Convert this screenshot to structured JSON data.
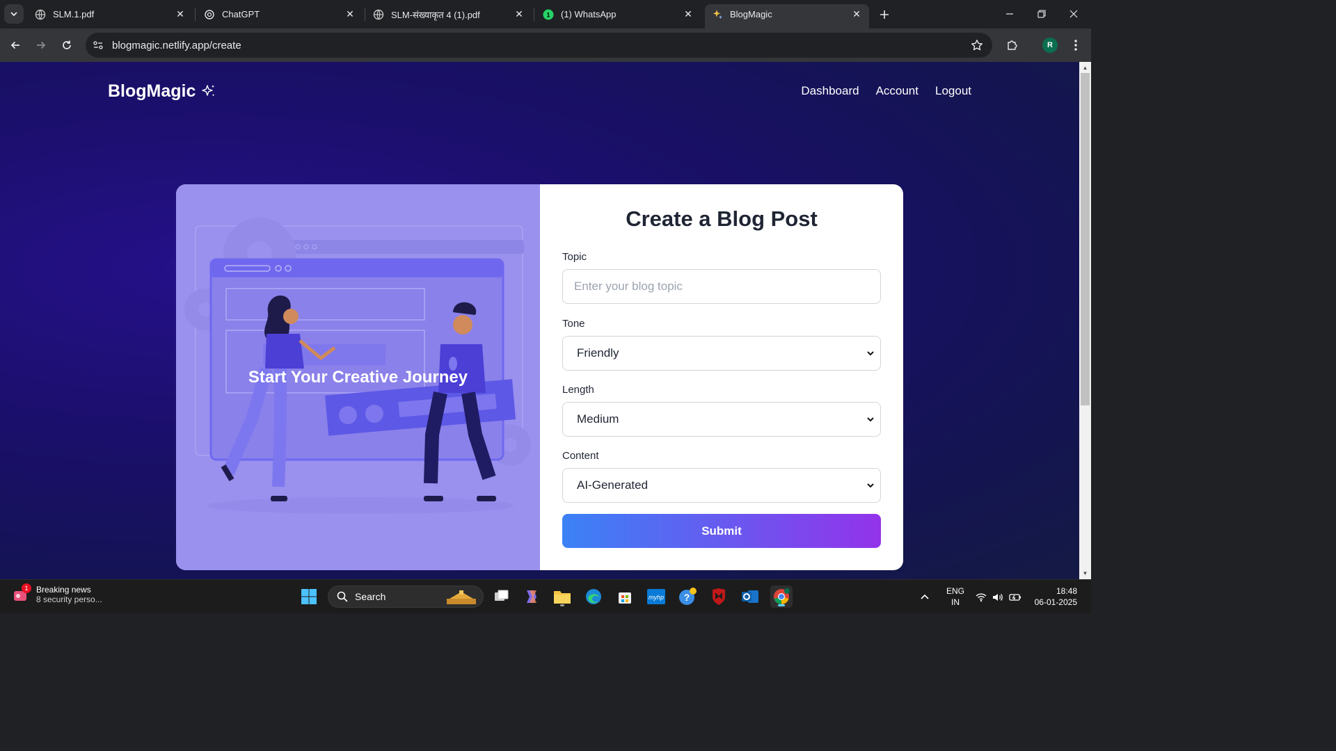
{
  "browser": {
    "tabs": [
      {
        "title": "SLM.1.pdf",
        "favicon": "globe-icon"
      },
      {
        "title": "ChatGPT",
        "favicon": "chatgpt-icon"
      },
      {
        "title": "SLM-संख्याकृत 4 (1).pdf",
        "favicon": "globe-icon"
      },
      {
        "title": "(1) WhatsApp",
        "favicon": "whatsapp-icon"
      },
      {
        "title": "BlogMagic",
        "favicon": "sparkle-icon",
        "active": true
      }
    ],
    "url": "blogmagic.netlify.app/create",
    "profile_initial": "R"
  },
  "site": {
    "brand": "BlogMagic",
    "nav": [
      "Dashboard",
      "Account",
      "Logout"
    ]
  },
  "hero": {
    "text": "Start Your Creative Journey"
  },
  "form": {
    "title": "Create a Blog Post",
    "topic_label": "Topic",
    "topic_placeholder": "Enter your blog topic",
    "topic_value": "",
    "tone_label": "Tone",
    "tone_value": "Friendly",
    "length_label": "Length",
    "length_value": "Medium",
    "content_label": "Content",
    "content_value": "AI-Generated",
    "submit_label": "Submit"
  },
  "taskbar": {
    "news_title": "Breaking news",
    "news_subtitle": "8 security perso...",
    "news_badge": "1",
    "search_label": "Search",
    "lang_line1": "ENG",
    "lang_line2": "IN",
    "time": "18:48",
    "date": "06-01-2025"
  },
  "colors": {
    "page_bg": "#1a0f6a",
    "panel_left": "#9a90ee",
    "submit_gradient_start": "#3b82f6",
    "submit_gradient_end": "#9333ea",
    "text_dark": "#1f2533"
  }
}
